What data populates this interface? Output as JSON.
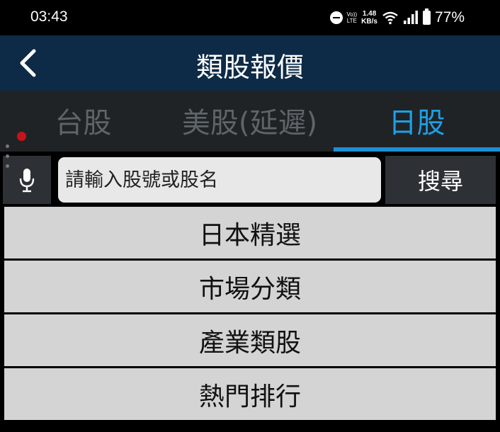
{
  "status_bar": {
    "time": "03:43",
    "volte_top": "Vo))",
    "volte_bottom": "LTE",
    "speed_value": "1.48",
    "speed_unit": "KB/s",
    "battery": "77%"
  },
  "header": {
    "title": "類股報價",
    "back_icon": "chevron-left-icon"
  },
  "tabs": [
    {
      "label": "台股",
      "active": false
    },
    {
      "label": "美股(延遲)",
      "active": false
    },
    {
      "label": "日股",
      "active": true
    }
  ],
  "search": {
    "placeholder": "請輸入股號或股名",
    "button_label": "搜尋",
    "mic_icon": "microphone-icon"
  },
  "menu": [
    {
      "label": "日本精選"
    },
    {
      "label": "市場分類"
    },
    {
      "label": "產業類股"
    },
    {
      "label": "熱門排行"
    }
  ],
  "colors": {
    "header_bg": "#0d2a46",
    "tab_active": "#1ea0e6",
    "tab_inactive": "#5f6469",
    "menu_bg": "#d4d4d4"
  }
}
